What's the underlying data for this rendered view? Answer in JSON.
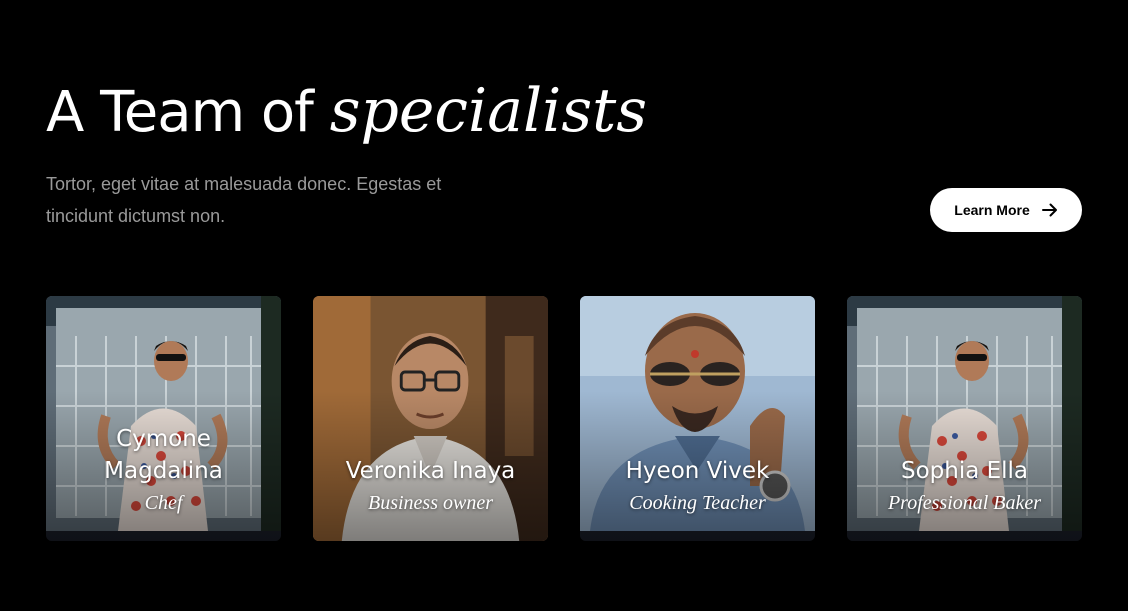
{
  "header": {
    "title_plain": "A Team of",
    "title_italic": "specialists",
    "subtitle": "Tortor, eget vitae at malesuada donec. Egestas et tincidunt dictumst non."
  },
  "cta": {
    "label": "Learn More",
    "icon": "arrow-right-icon"
  },
  "team": [
    {
      "name": "Cymone Magdalina",
      "role": "Chef",
      "photo": "man-in-patterned-shirt-sunglasses"
    },
    {
      "name": "Veronika Inaya",
      "role": "Business owner",
      "photo": "man-in-glasses-white-shirt"
    },
    {
      "name": "Hyeon Vivek",
      "role": "Cooking Teacher",
      "photo": "man-in-sunglasses-blue-shirt"
    },
    {
      "name": "Sophia Ella",
      "role": "Professional Baker",
      "photo": "man-in-patterned-shirt-sunglasses"
    }
  ],
  "colors": {
    "background": "#000000",
    "text": "#ffffff",
    "muted_text": "#9a9a9a",
    "button_bg": "#ffffff",
    "card_bg": "#1b1f2a"
  }
}
